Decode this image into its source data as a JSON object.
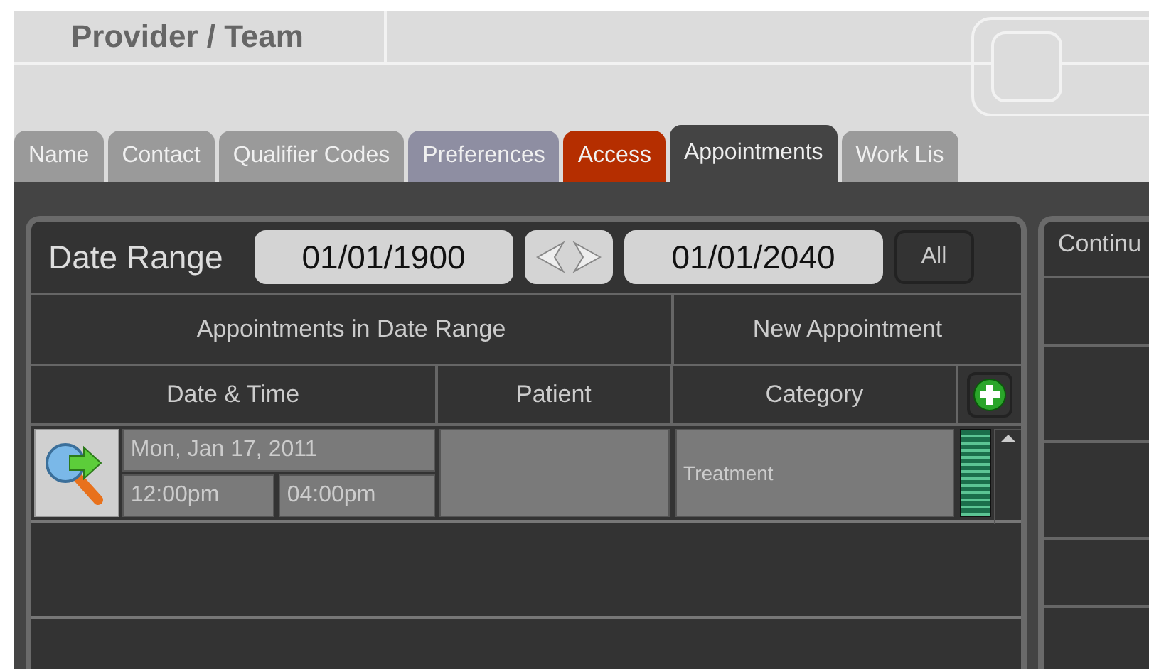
{
  "header": {
    "title": "Provider / Team"
  },
  "tabs": [
    {
      "label": "Name",
      "selected": false,
      "color": "#9a9a9a"
    },
    {
      "label": "Contact",
      "selected": false,
      "color": "#9a9a9a"
    },
    {
      "label": "Qualifier Codes",
      "selected": false,
      "color": "#9a9a9a"
    },
    {
      "label": "Preferences",
      "selected": false,
      "color": "#8e8ea2"
    },
    {
      "label": "Access",
      "selected": false,
      "color": "#b52e00"
    },
    {
      "label": "Appointments",
      "selected": true
    },
    {
      "label": "Work Lis",
      "selected": false,
      "color": "#9a9a9a"
    }
  ],
  "date_range": {
    "label": "Date Range",
    "start": "01/01/1900",
    "end": "01/01/2040",
    "all_button": "All"
  },
  "appointments": {
    "group_headers": [
      "Appointments in Date Range",
      "New Appointment"
    ],
    "columns": [
      "Date & Time",
      "Patient",
      "Category"
    ],
    "rows": [
      {
        "date": "Mon, Jan 17, 2011",
        "start_time": "12:00pm",
        "end_time": "04:00pm",
        "category": "Treatment"
      }
    ]
  },
  "side_panel": {
    "title": "Continu"
  }
}
